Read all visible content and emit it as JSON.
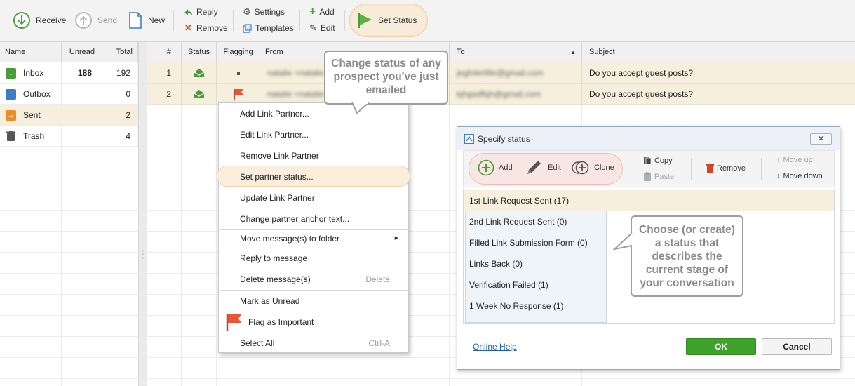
{
  "toolbar": {
    "receive": "Receive",
    "send": "Send",
    "new": "New",
    "reply": "Reply",
    "remove": "Remove",
    "settings": "Settings",
    "templates": "Templates",
    "add": "Add",
    "edit": "Edit",
    "set_status": "Set Status"
  },
  "folders": {
    "headers": {
      "name": "Name",
      "unread": "Unread",
      "total": "Total"
    },
    "items": [
      {
        "name": "Inbox",
        "unread": "188",
        "total": "192"
      },
      {
        "name": "Outbox",
        "unread": "",
        "total": "0"
      },
      {
        "name": "Sent",
        "unread": "",
        "total": "2"
      },
      {
        "name": "Trash",
        "unread": "",
        "total": "4"
      }
    ]
  },
  "messages": {
    "headers": {
      "num": "#",
      "status": "Status",
      "flagging": "Flagging",
      "from": "From",
      "to": "To",
      "subject": "Subject"
    },
    "rows": [
      {
        "num": "1",
        "from": "natalie <natalie",
        "to": "jegfolerlille@gmail.com",
        "subject": "Do you accept guest posts?"
      },
      {
        "num": "2",
        "from": "natalie <natalie",
        "to": "kjhgsdfkjh@gmail.com",
        "subject": "Do you accept guest posts?"
      }
    ]
  },
  "context_menu": {
    "items": [
      {
        "label": "Add Link Partner..."
      },
      {
        "label": "Edit Link Partner..."
      },
      {
        "label": "Remove Link Partner"
      },
      {
        "label": "Set partner status..."
      },
      {
        "label": "Update Link Partner"
      },
      {
        "label": "Change partner anchor text..."
      },
      {
        "label": "Move message(s) to folder"
      },
      {
        "label": "Reply to message"
      },
      {
        "label": "Delete message(s)",
        "shortcut": "Delete"
      },
      {
        "label": "Mark as Unread"
      },
      {
        "label": "Flag as Important"
      },
      {
        "label": "Select All",
        "shortcut": "Ctrl-A"
      }
    ]
  },
  "callouts": {
    "top": "Change status of any prospect you've just emailed",
    "right": "Choose (or create) a status that describes the current stage of your conversation"
  },
  "dialog": {
    "title": "Specify status",
    "toolbar": {
      "add": "Add",
      "edit": "Edit",
      "clone": "Clone",
      "copy": "Copy",
      "paste": "Paste",
      "remove": "Remove",
      "move_up": "Move up",
      "move_down": "Move down"
    },
    "statuses": [
      "1st Link Request Sent (17)",
      "2nd Link Request Sent (0)",
      "Filled Link Submission Form (0)",
      "Links Back (0)",
      "Verification Failed (1)",
      "1 Week No Response (1)"
    ],
    "help_link": "Online Help",
    "ok": "OK",
    "cancel": "Cancel"
  },
  "colors": {
    "accent_orange": "#f3cfa6",
    "selected_row": "#f6efdd",
    "ok_green": "#3fa22b",
    "flag_red": "#e8563a"
  }
}
